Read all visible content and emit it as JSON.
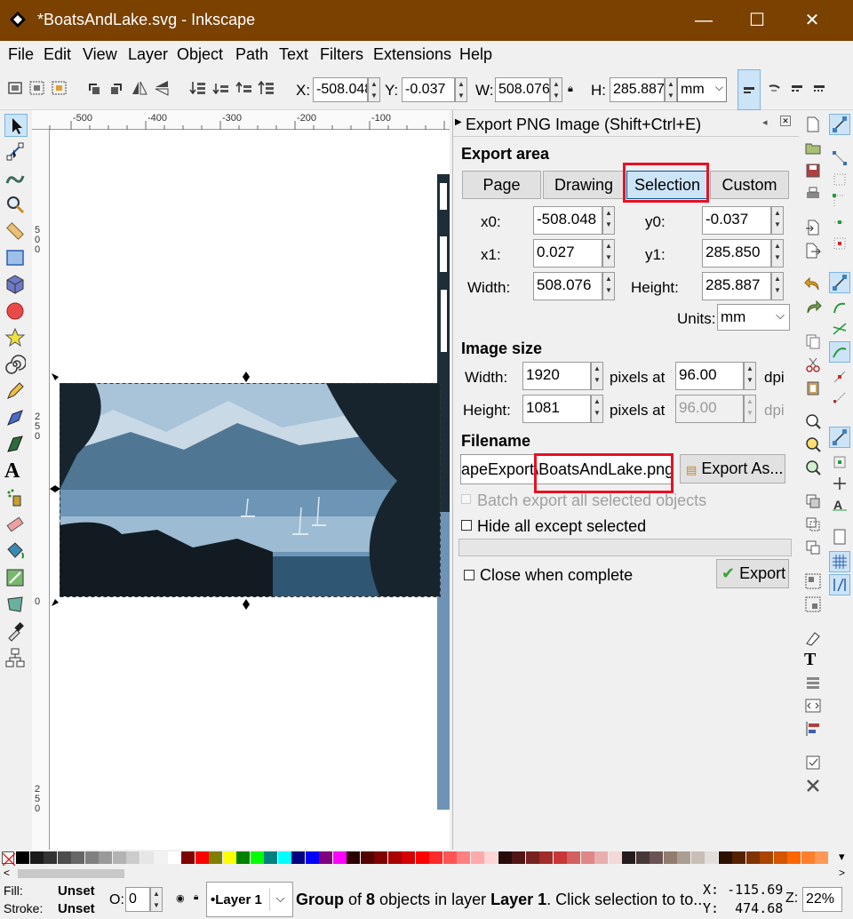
{
  "window": {
    "title": "*BoatsAndLake.svg - Inkscape",
    "minimize": "—",
    "maximize": "☐",
    "close": "✕"
  },
  "menu": [
    "File",
    "Edit",
    "View",
    "Layer",
    "Object",
    "Path",
    "Text",
    "Filters",
    "Extensions",
    "Help"
  ],
  "toolbar": {
    "x_label": "X:",
    "x_value": "-508.048",
    "y_label": "Y:",
    "y_value": "-0.037",
    "w_label": "W:",
    "w_value": "508.076",
    "h_label": "H:",
    "h_value": "285.887",
    "unit": "mm"
  },
  "ruler": {
    "top_ticks": [
      "-500",
      "-400",
      "-300",
      "-200",
      "-100"
    ],
    "left_ticks": [
      "5\n0\n0",
      "2\n5\n0",
      "0",
      "2\n5\n0"
    ]
  },
  "dialog": {
    "title": "Export PNG Image (Shift+Ctrl+E)",
    "export_area_heading": "Export area",
    "tabs": [
      "Page",
      "Drawing",
      "Selection",
      "Custom"
    ],
    "x0_label": "x0:",
    "x0": "-508.048",
    "y0_label": "y0:",
    "y0": "-0.037",
    "x1_label": "x1:",
    "x1": "0.027",
    "y1_label": "y1:",
    "y1": "285.850",
    "width_label": "Width:",
    "width": "508.076",
    "height_label": "Height:",
    "height": "285.887",
    "units_label": "Units:",
    "units": "mm",
    "image_size_heading": "Image size",
    "img_width_label": "Width:",
    "img_width": "1920",
    "img_height_label": "Height:",
    "img_height": "1081",
    "pixels_at": "pixels at",
    "dpi_x": "96.00",
    "dpi_y": "96.00",
    "dpi": "dpi",
    "filename_heading": "Filename",
    "filename_left": "apeExport\\",
    "filename_right": "BoatsAndLake.png",
    "export_as": "Export As...",
    "batch_export": "Batch export all selected objects",
    "hide_all": "Hide all except selected",
    "close_when_complete": "Close when complete",
    "export": "Export"
  },
  "status": {
    "fill_label": "Fill:",
    "fill_value": "Unset",
    "stroke_label": "Stroke:",
    "stroke_value": "Unset",
    "opacity_label": "O:",
    "opacity_value": "0",
    "layer": "•Layer 1",
    "message_pre": "Group",
    "message_mid": " of ",
    "message_count": "8",
    "message_mid2": " objects in layer ",
    "message_layer": "Layer 1",
    "message_post": ". Click selection to to...",
    "cursor_x": "X: -115.69",
    "cursor_y": "Y:  474.68",
    "zoom_label": "Z:",
    "zoom": "22%"
  },
  "palette_colors": [
    "#000000",
    "#1a1a1a",
    "#333333",
    "#4d4d4d",
    "#666666",
    "#808080",
    "#999999",
    "#b3b3b3",
    "#cccccc",
    "#e6e6e6",
    "#f2f2f2",
    "#ffffff",
    "#800000",
    "#ff0000",
    "#808000",
    "#ffff00",
    "#008000",
    "#00ff00",
    "#008080",
    "#00ffff",
    "#000080",
    "#0000ff",
    "#800080",
    "#ff00ff",
    "#2b0000",
    "#550000",
    "#800000",
    "#aa0000",
    "#d40000",
    "#ff0000",
    "#ff2a2a",
    "#ff5555",
    "#ff8080",
    "#ffaaaa",
    "#ffd5d5",
    "#280b0b",
    "#501616",
    "#782121",
    "#a02c2c",
    "#c83737",
    "#d35f5f",
    "#de8787",
    "#e9afaf",
    "#f4d7d7",
    "#241c1c",
    "#483737",
    "#6c5353",
    "#917c6f",
    "#ac9d93",
    "#c8beb7",
    "#e3dedb",
    "#2b1100",
    "#552200",
    "#803300",
    "#aa4400",
    "#d45500",
    "#ff6600",
    "#ff7f2a",
    "#ff9955"
  ]
}
